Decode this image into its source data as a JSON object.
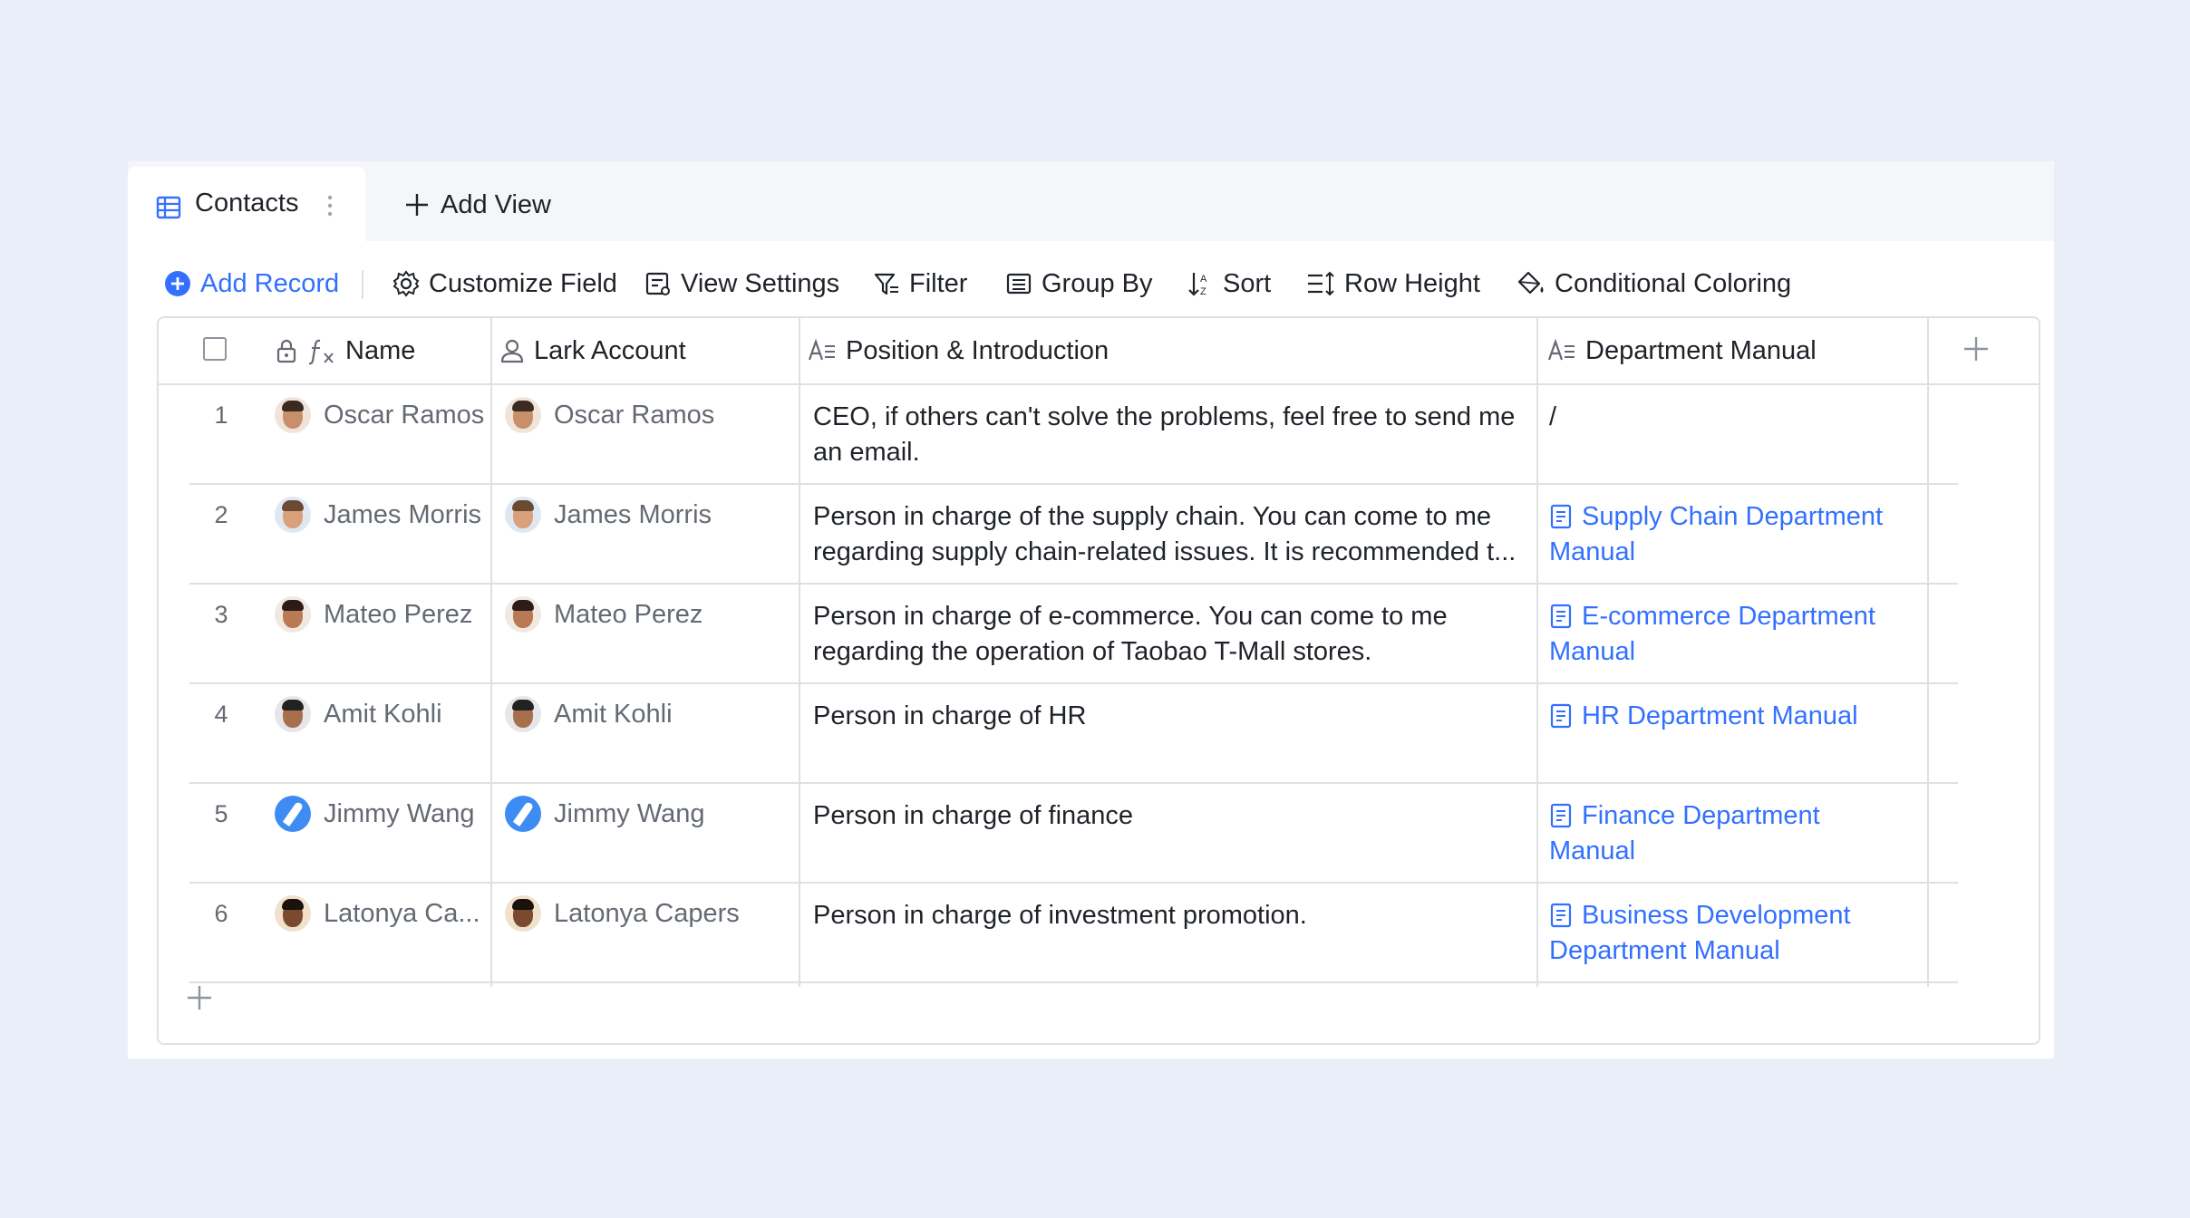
{
  "tabs": {
    "active_label": "Contacts",
    "add_view_label": "Add View"
  },
  "toolbar": {
    "add_record": "Add Record",
    "customize_field": "Customize Field",
    "view_settings": "View Settings",
    "filter": "Filter",
    "group_by": "Group By",
    "sort": "Sort",
    "row_height": "Row Height",
    "conditional_coloring": "Conditional Coloring"
  },
  "columns": {
    "name": "Name",
    "lark_account": "Lark Account",
    "position": "Position & Introduction",
    "manual": "Department Manual"
  },
  "rows": [
    {
      "num": "1",
      "name": "Oscar Ramos",
      "account": "Oscar Ramos",
      "position_line1": "CEO, if others can't solve the problems, feel free to send me",
      "position_line2": "an email.",
      "manual_line1": "/",
      "manual_line2": "",
      "manual_is_link": false
    },
    {
      "num": "2",
      "name": "James Morris",
      "account": "James Morris",
      "position_line1": "Person in charge of the supply chain. You can come to me",
      "position_line2": "regarding supply chain-related issues. It is recommended t...",
      "manual_line1": "Supply Chain Department",
      "manual_line2": "Manual",
      "manual_is_link": true
    },
    {
      "num": "3",
      "name": "Mateo Perez",
      "account": "Mateo Perez",
      "position_line1": "Person in charge of e-commerce. You can come to me",
      "position_line2": "regarding the operation of Taobao T-Mall stores.",
      "manual_line1": "E-commerce Department",
      "manual_line2": "Manual",
      "manual_is_link": true
    },
    {
      "num": "4",
      "name": "Amit Kohli",
      "account": "Amit Kohli",
      "position_line1": "Person in charge of HR",
      "position_line2": "",
      "manual_line1": "HR Department Manual",
      "manual_line2": "",
      "manual_is_link": true
    },
    {
      "num": "5",
      "name": "Jimmy Wang",
      "account": "Jimmy Wang",
      "position_line1": "Person in charge of finance",
      "position_line2": "",
      "manual_line1": "Finance Department",
      "manual_line2": "Manual",
      "manual_is_link": true
    },
    {
      "num": "6",
      "name": "Latonya Ca...",
      "account": "Latonya Capers",
      "position_line1": "Person in charge of investment promotion.",
      "position_line2": "",
      "manual_line1": "Business Development",
      "manual_line2": "Department Manual",
      "manual_is_link": true
    }
  ],
  "colors": {
    "accent": "#3370ff",
    "background": "#eaeef8",
    "border": "#dee0e3",
    "text_primary": "#1f2329",
    "text_secondary": "#646a73"
  },
  "icons": {
    "tab": "table-grid-icon",
    "more": "more-vertical-icon",
    "add_view": "plus-icon",
    "add_record": "plus-circle-icon",
    "customize_field": "gear-icon",
    "view_settings": "settings-doc-icon",
    "filter": "filter-icon",
    "group_by": "group-list-icon",
    "sort": "sort-icon",
    "row_height": "row-height-icon",
    "conditional_coloring": "paint-bucket-icon",
    "name_col": "lock-icon",
    "formula": "formula-icon",
    "lark_account": "person-icon",
    "text_field": "text-field-icon",
    "doc": "document-icon"
  }
}
